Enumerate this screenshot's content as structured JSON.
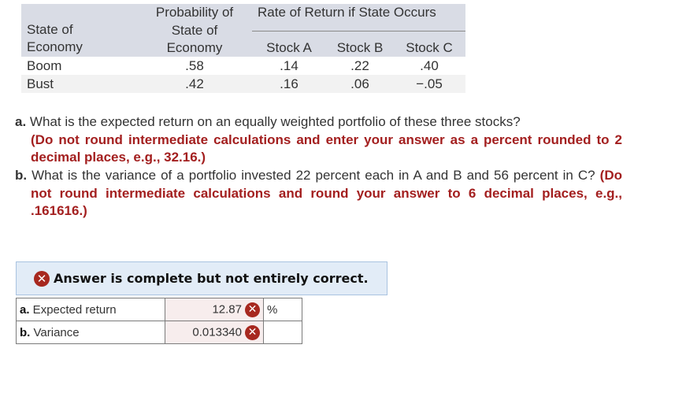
{
  "table": {
    "headers": {
      "state": [
        "State of",
        "Economy"
      ],
      "probability": [
        "Probability of",
        "State of",
        "Economy"
      ],
      "group": "Rate of Return if State Occurs",
      "stocks": [
        "Stock A",
        "Stock B",
        "Stock C"
      ]
    },
    "rows": [
      {
        "state": "Boom",
        "probability": ".58",
        "a": ".14",
        "b": ".22",
        "c": ".40"
      },
      {
        "state": "Bust",
        "probability": ".42",
        "a": ".16",
        "b": ".06",
        "c": "−.05"
      }
    ]
  },
  "questions": {
    "a": {
      "label": "a.",
      "text": "What is the expected return on an equally weighted portfolio of these three stocks?",
      "instruction": "(Do not round intermediate calculations and enter your answer as a percent rounded to 2 decimal places, e.g., 32.16.)"
    },
    "b": {
      "label": "b.",
      "text": "What is the variance of a portfolio invested 22 percent each in A and B and 56 percent in C?",
      "instruction": "(Do not round intermediate calculations and round your answer to 6 decimal places, e.g., .161616.)"
    }
  },
  "feedback": {
    "icon": "incorrect-x-icon",
    "message": "Answer is complete but not entirely correct."
  },
  "answers": [
    {
      "label_prefix": "a.",
      "label": " Expected return",
      "value": "12.87",
      "status": "incorrect",
      "unit": "%"
    },
    {
      "label_prefix": "b.",
      "label": " Variance",
      "value": "0.013340",
      "status": "incorrect",
      "unit": ""
    }
  ],
  "colors": {
    "header_bg": "#d9dce5",
    "instruction_red": "#a31f1f",
    "incorrect_icon": "#a7281f",
    "banner_bg": "#e2ecf7",
    "answer_cell_bg": "#f7eded"
  }
}
